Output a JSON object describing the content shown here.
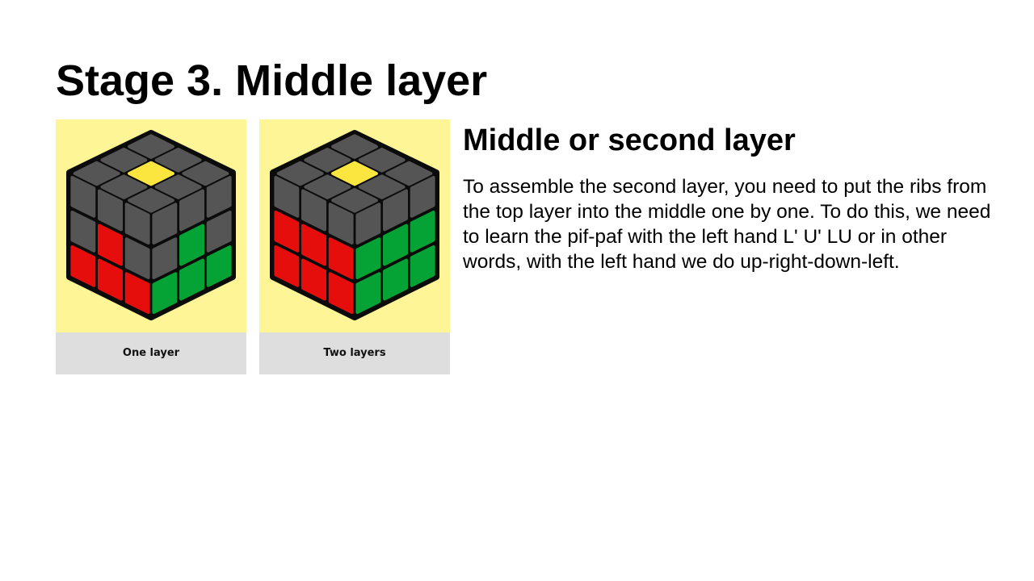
{
  "page": {
    "title": "Stage 3. Middle layer"
  },
  "figures": [
    {
      "caption": "One layer",
      "cube": {
        "top": [
          [
            "gray",
            "gray",
            "gray"
          ],
          [
            "gray",
            "yellow",
            "gray"
          ],
          [
            "gray",
            "gray",
            "gray"
          ]
        ],
        "left": [
          [
            "gray",
            "gray",
            "gray"
          ],
          [
            "gray",
            "red",
            "gray"
          ],
          [
            "red",
            "red",
            "red"
          ]
        ],
        "right": [
          [
            "gray",
            "gray",
            "gray"
          ],
          [
            "gray",
            "green",
            "gray"
          ],
          [
            "green",
            "green",
            "green"
          ]
        ]
      }
    },
    {
      "caption": "Two layers",
      "cube": {
        "top": [
          [
            "gray",
            "gray",
            "gray"
          ],
          [
            "gray",
            "yellow",
            "gray"
          ],
          [
            "gray",
            "gray",
            "gray"
          ]
        ],
        "left": [
          [
            "gray",
            "gray",
            "gray"
          ],
          [
            "red",
            "red",
            "red"
          ],
          [
            "red",
            "red",
            "red"
          ]
        ],
        "right": [
          [
            "gray",
            "gray",
            "gray"
          ],
          [
            "green",
            "green",
            "green"
          ],
          [
            "green",
            "green",
            "green"
          ]
        ]
      }
    }
  ],
  "content": {
    "heading": "Middle or second layer",
    "body": "To assemble the second layer, you need to put the ribs from the top layer into the middle one by one. To do this, we need to learn the pif-paf with the left hand L' U' LU or in other words, with the left hand we do up-right-down-left."
  },
  "colors": {
    "gray": "#555555",
    "yellow": "#fbe53f",
    "red": "#e60d0d",
    "green": "#05a335",
    "cube_body": "#0b0b0b",
    "image_background": "#fef596",
    "caption_background": "#dedede"
  }
}
